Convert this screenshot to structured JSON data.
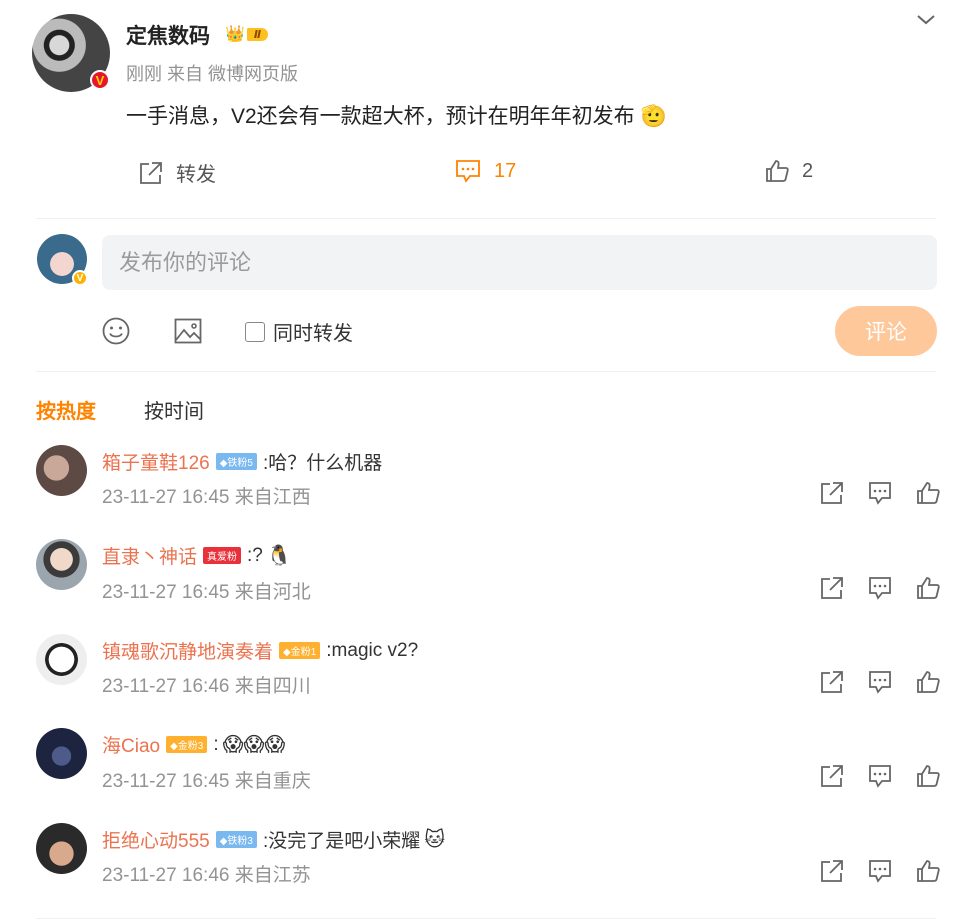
{
  "post": {
    "author": "定焦数码",
    "level_badge": "Ⅱ",
    "meta": "刚刚 来自 微博网页版",
    "text": "一手消息，V2还会有一款超大杯，预计在明年年初发布",
    "text_emoji": "🫡",
    "actions": {
      "repost_label": "转发",
      "comment_count": "17",
      "like_count": "2"
    }
  },
  "compose": {
    "placeholder": "发布你的评论",
    "repost_checkbox_label": "同时转发",
    "submit_label": "评论"
  },
  "sort_tabs": [
    "按热度",
    "按时间"
  ],
  "comments": [
    {
      "name": "箱子童鞋126",
      "badge": "◆铁粉5",
      "badge_color": "#7ab8f0",
      "text": ":哈？什么机器",
      "emoji": "",
      "time": "23-11-27 16:45 来自江西"
    },
    {
      "name": "直隶丶神话",
      "badge": "真爱粉",
      "badge_color": "#e8313b",
      "text": ":?",
      "emoji": "🐧",
      "time": "23-11-27 16:45 来自河北"
    },
    {
      "name": "镇魂歌沉静地演奏着",
      "badge": "◆金粉1",
      "badge_color": "#ffb02e",
      "text": ":magic v2?",
      "emoji": "",
      "time": "23-11-27 16:46 来自四川"
    },
    {
      "name": "海Ciao",
      "badge": "◆金粉3",
      "badge_color": "#ffb02e",
      "text": ":",
      "emoji": "😱😱😱",
      "time": "23-11-27 16:45 来自重庆"
    },
    {
      "name": "拒绝心动555",
      "badge": "◆铁粉3",
      "badge_color": "#7ab8f0",
      "text": ":没完了是吧小荣耀",
      "emoji": "🐱",
      "time": "23-11-27 16:46 来自江苏"
    }
  ]
}
